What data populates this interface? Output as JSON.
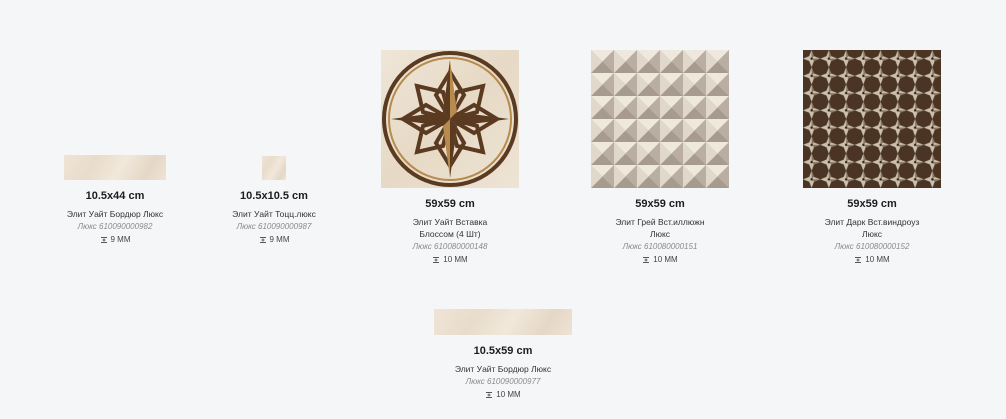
{
  "products": [
    {
      "size": "10.5x44 cm",
      "name": "Элит Уайт Бордюр Люкс",
      "code": "Люкс 610090000982",
      "thickness": "9 MM",
      "tile": "border"
    },
    {
      "size": "10.5x10.5 cm",
      "name": "Элит Уайт Тоцц.люкс",
      "code": "Люкс 610090000987",
      "thickness": "9 MM",
      "tile": "small-square"
    },
    {
      "size": "59x59 cm",
      "name": "Элит Уайт Вставка Блоссом (4 Шт)",
      "code": "Люкс 610080000148",
      "thickness": "10 MM",
      "tile": "compass"
    },
    {
      "size": "59x59 cm",
      "name": "Элит Грей Вст.иллюжн Люкс",
      "code": "Люкс 610080000151",
      "thickness": "10 MM",
      "tile": "grey-pyramids"
    },
    {
      "size": "59x59 cm",
      "name": "Элит Дарк Вст.виндроуз Люкс",
      "code": "Люкс 610080000152",
      "thickness": "10 MM",
      "tile": "dark-stars"
    },
    {
      "size": "10.5x59 cm",
      "name": "Элит Уайт Бордюр Люкс",
      "code": "Люкс 610090000977",
      "thickness": "10 MM",
      "tile": "border-long"
    }
  ],
  "icons": {
    "thickness": "thickness-icon"
  },
  "colors": {
    "background": "#f5f6f8",
    "beige": "#eadfcf",
    "brown": "#5a3a20",
    "gold": "#b78a4e"
  }
}
